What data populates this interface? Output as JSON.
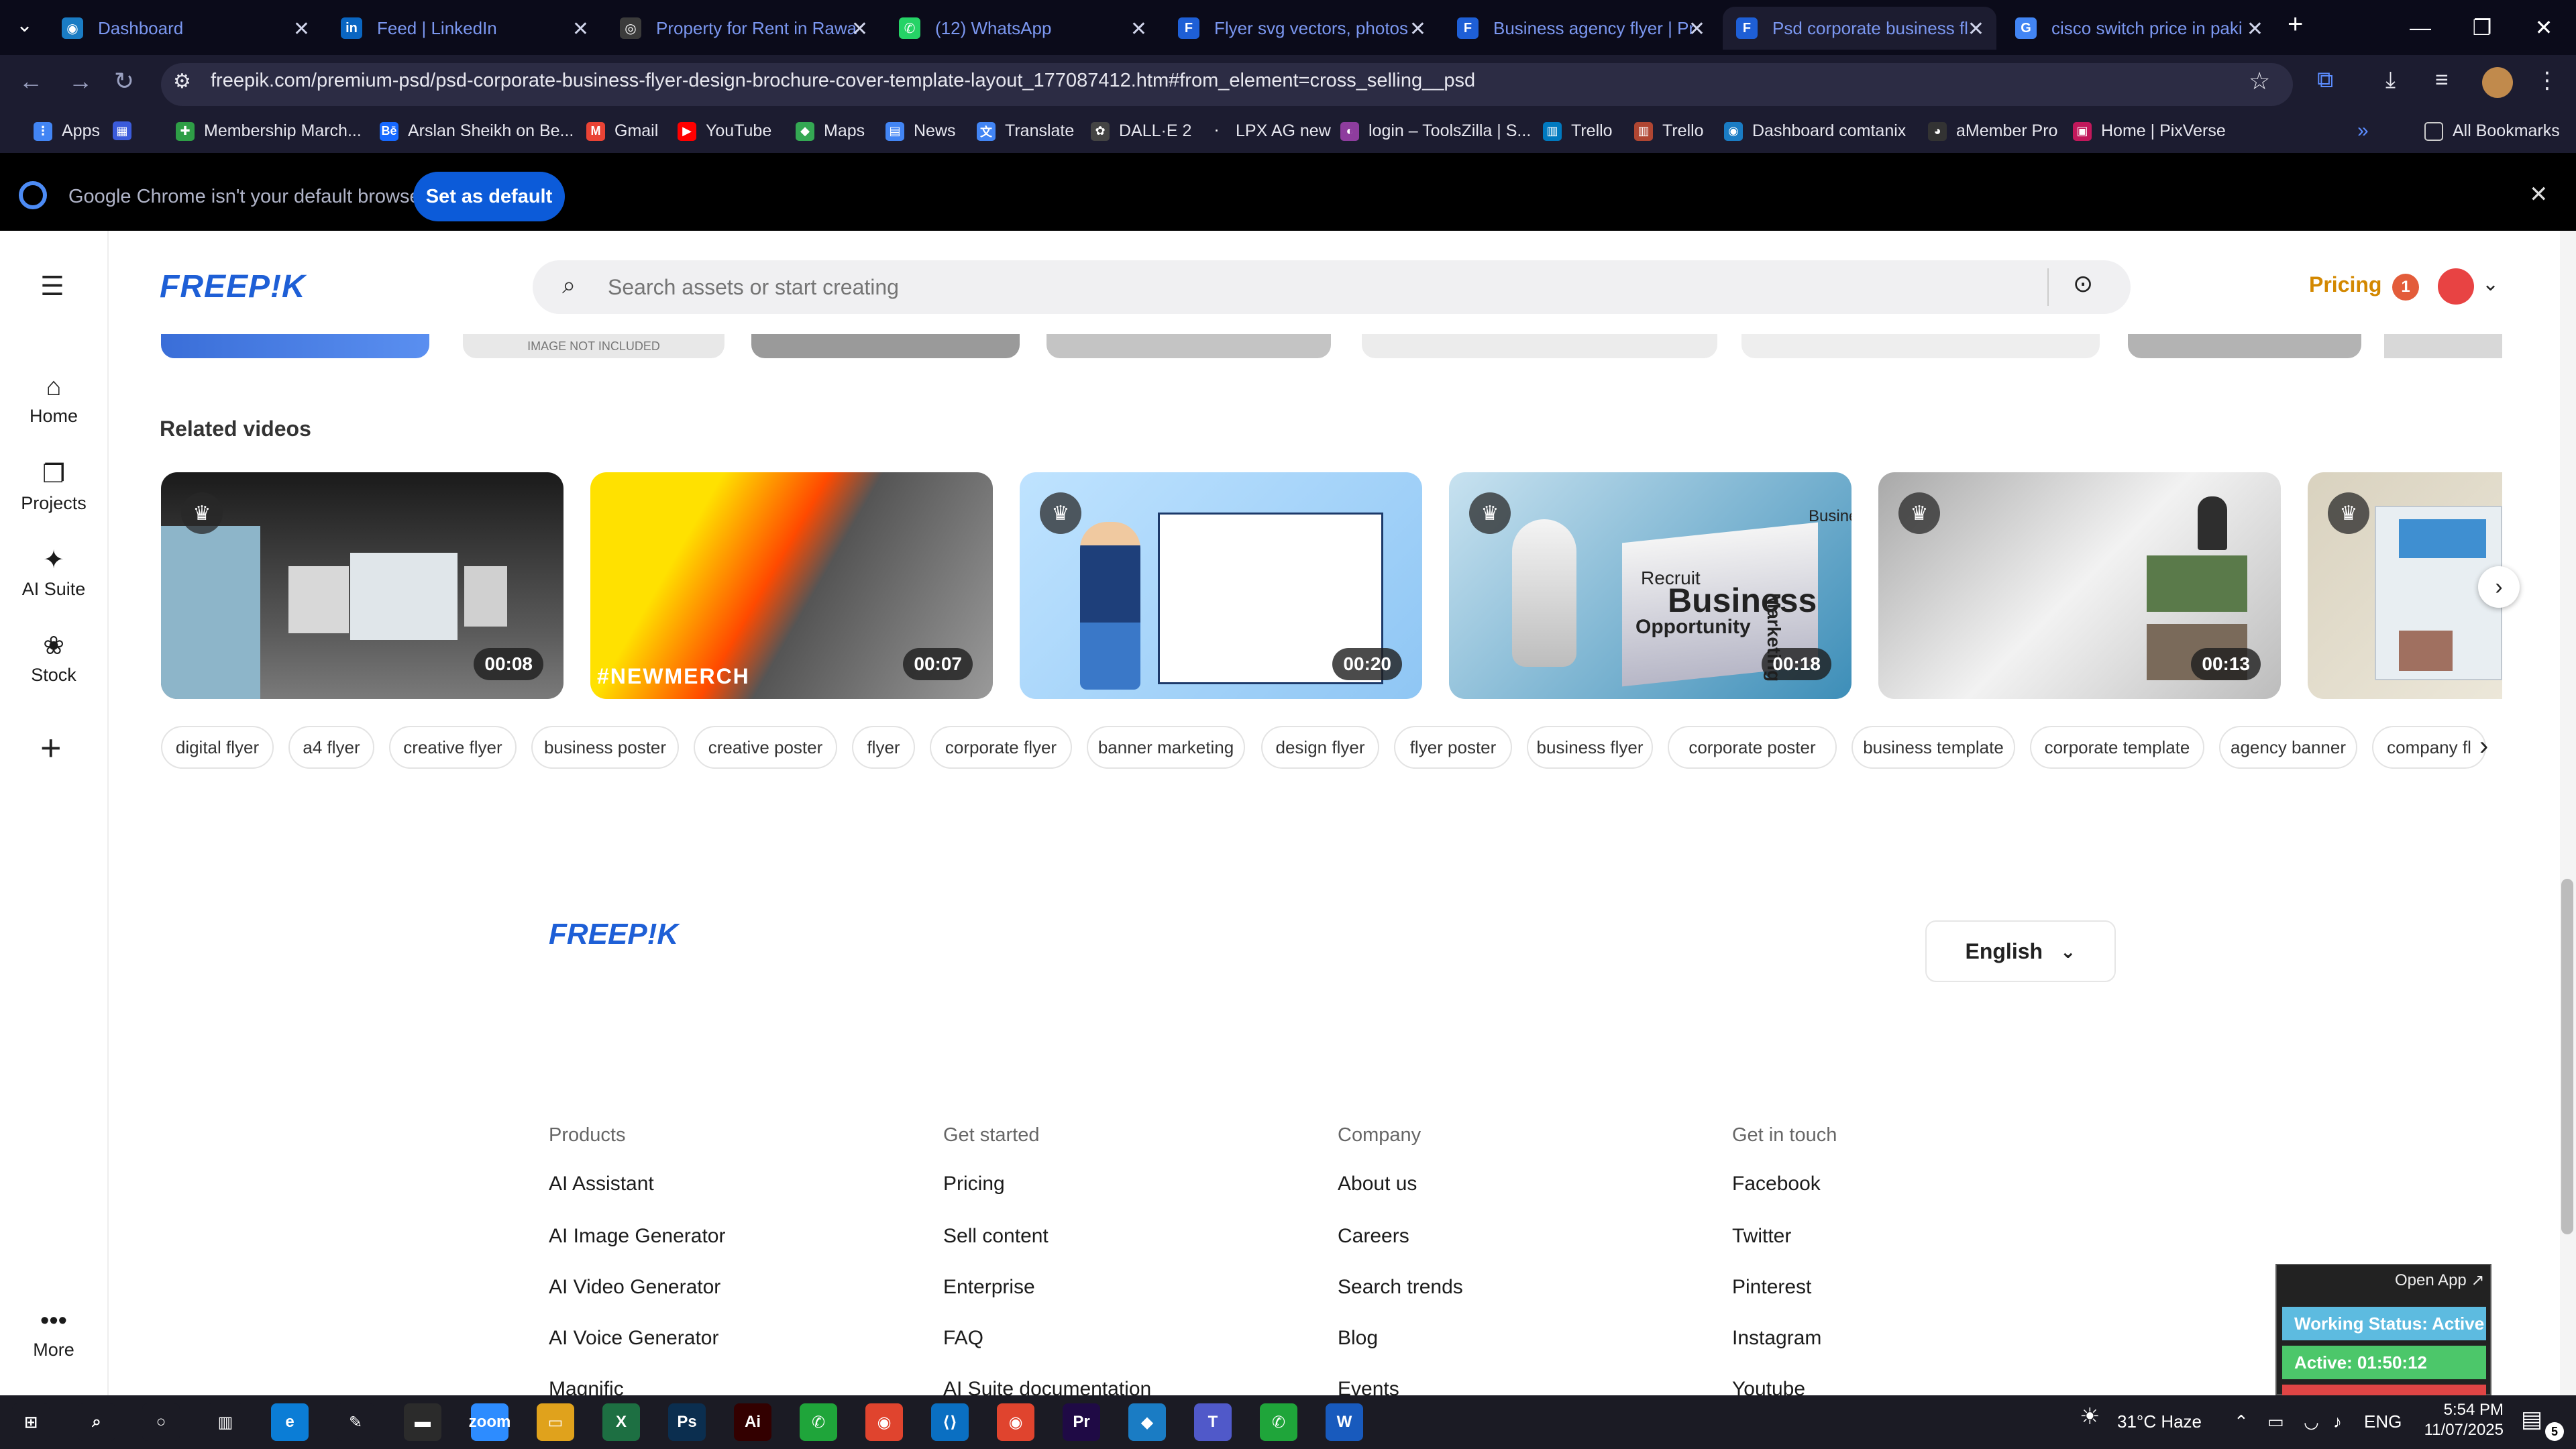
{
  "browser": {
    "tabs": [
      {
        "title": "Dashboard",
        "fav_color": "#1a7cc4",
        "fav_glyph": "◉"
      },
      {
        "title": "Feed | LinkedIn",
        "fav_color": "#0a66c2",
        "fav_glyph": "in"
      },
      {
        "title": "Property for Rent in Rawa",
        "fav_color": "#3b3b3b",
        "fav_glyph": "◎"
      },
      {
        "title": "(12) WhatsApp",
        "fav_color": "#25d366",
        "fav_glyph": "✆"
      },
      {
        "title": "Flyer svg vectors, photos",
        "fav_color": "#1e5fd6",
        "fav_glyph": "F"
      },
      {
        "title": "Business agency flyer | Pr",
        "fav_color": "#1e5fd6",
        "fav_glyph": "F"
      },
      {
        "title": "Psd corporate business fl",
        "fav_color": "#1e5fd6",
        "fav_glyph": "F"
      },
      {
        "title": "cisco switch price in paki",
        "fav_color": "#4285f4",
        "fav_glyph": "G"
      }
    ],
    "url": "freepik.com/premium-psd/psd-corporate-business-flyer-design-brochure-cover-template-layout_177087412.htm#from_element=cross_selling__psd",
    "bookmarks": [
      {
        "label": "Apps",
        "color": "#4285f4",
        "glyph": "⋮"
      },
      {
        "label": "",
        "color": "#3b5bdb",
        "glyph": "▦"
      },
      {
        "label": "Membership March...",
        "color": "#2e9e46",
        "glyph": "✚"
      },
      {
        "label": "Arslan Sheikh on Be...",
        "color": "#1769ff",
        "glyph": "Bē"
      },
      {
        "label": "Gmail",
        "color": "#ea4335",
        "glyph": "M"
      },
      {
        "label": "YouTube",
        "color": "#ff0000",
        "glyph": "▶"
      },
      {
        "label": "Maps",
        "color": "#34a853",
        "glyph": "◆"
      },
      {
        "label": "News",
        "color": "#4285f4",
        "glyph": "▤"
      },
      {
        "label": "Translate",
        "color": "#4285f4",
        "glyph": "文"
      },
      {
        "label": "DALL·E 2",
        "color": "#444",
        "glyph": "✿"
      },
      {
        "label": "LPX AG new",
        "color": "#1c1c30",
        "glyph": "·"
      },
      {
        "label": "login – ToolsZilla | S...",
        "color": "#8e3d9e",
        "glyph": "◐"
      },
      {
        "label": "Trello",
        "color": "#0079bf",
        "glyph": "▥"
      },
      {
        "label": "Trello",
        "color": "#b04632",
        "glyph": "▥"
      },
      {
        "label": "Dashboard comtanix",
        "color": "#1a7cc4",
        "glyph": "◉"
      },
      {
        "label": "aMember Pro",
        "color": "#333",
        "glyph": "◕"
      },
      {
        "label": "Home | PixVerse",
        "color": "#c2185b",
        "glyph": "▣"
      }
    ],
    "all_bookmarks": "All Bookmarks",
    "infobar_text": "Google Chrome isn't your default browser",
    "set_default": "Set as default"
  },
  "site": {
    "logo": "FREEP!K",
    "search_placeholder": "Search assets or start creating",
    "pricing": "Pricing",
    "notif_count": "1",
    "image_not_included": "IMAGE NOT INCLUDED",
    "sidebar": [
      {
        "label": "Home",
        "glyph": "⌂"
      },
      {
        "label": "Projects",
        "glyph": "❐"
      },
      {
        "label": "AI Suite",
        "glyph": "✦"
      },
      {
        "label": "Stock",
        "glyph": "❀"
      }
    ],
    "more": "More",
    "related_videos": "Related videos",
    "videos": [
      {
        "duration": "00:08"
      },
      {
        "duration": "00:07",
        "overlay": "#NEWMERCH"
      },
      {
        "duration": "00:20"
      },
      {
        "duration": "00:18",
        "text1": "Recruit",
        "text2": "Business",
        "text3": "Opportunity",
        "text4": "Marketing",
        "text5": "Busines"
      },
      {
        "duration": "00:13"
      },
      {
        "duration": ""
      }
    ],
    "tags": [
      "digital flyer",
      "a4 flyer",
      "creative flyer",
      "business poster",
      "creative poster",
      "flyer",
      "corporate flyer",
      "banner marketing",
      "design flyer",
      "flyer poster",
      "business flyer",
      "corporate poster",
      "business template",
      "corporate template",
      "agency banner",
      "company fl"
    ],
    "language": "English",
    "footer": {
      "columns": [
        {
          "heading": "Products",
          "links": [
            "AI Assistant",
            "AI Image Generator",
            "AI Video Generator",
            "AI Voice Generator",
            "Magnific"
          ]
        },
        {
          "heading": "Get started",
          "links": [
            "Pricing",
            "Sell content",
            "Enterprise",
            "FAQ",
            "AI Suite documentation"
          ]
        },
        {
          "heading": "Company",
          "links": [
            "About us",
            "Careers",
            "Search trends",
            "Blog",
            "Events"
          ]
        },
        {
          "heading": "Get in touch",
          "links": [
            "Facebook",
            "Twitter",
            "Pinterest",
            "Instagram",
            "Youtube"
          ]
        }
      ]
    }
  },
  "widget": {
    "open_app": "Open App ↗",
    "status": "Working Status: Active",
    "active": "Active: 01:50:12"
  },
  "taskbar": {
    "apps": [
      {
        "glyph": "⊞",
        "color": "#1b1b24"
      },
      {
        "glyph": "⌕",
        "color": "#1b1b24"
      },
      {
        "glyph": "○",
        "color": "#1b1b24"
      },
      {
        "glyph": "▥",
        "color": "#1b1b24"
      },
      {
        "glyph": "e",
        "color": "#0b7dd6"
      },
      {
        "glyph": "✎",
        "color": "#1b1b24"
      },
      {
        "glyph": "▬",
        "color": "#2b2b2b"
      },
      {
        "glyph": "zoom",
        "color": "#2d8cff"
      },
      {
        "glyph": "▭",
        "color": "#e0a21c"
      },
      {
        "glyph": "X",
        "color": "#1d6f42"
      },
      {
        "glyph": "Ps",
        "color": "#0b2e4f"
      },
      {
        "glyph": "Ai",
        "color": "#330000"
      },
      {
        "glyph": "✆",
        "color": "#1fa53a"
      },
      {
        "glyph": "◉",
        "color": "#e0442e"
      },
      {
        "glyph": "⟨⟩",
        "color": "#0a6fc2"
      },
      {
        "glyph": "◉",
        "color": "#e0442e"
      },
      {
        "glyph": "Pr",
        "color": "#1f0a45"
      },
      {
        "glyph": "◆",
        "color": "#1a7cc4"
      },
      {
        "glyph": "T",
        "color": "#5059c9"
      },
      {
        "glyph": "✆",
        "color": "#1fa53a"
      },
      {
        "glyph": "W",
        "color": "#185abd"
      }
    ],
    "weather": "31°C  Haze",
    "lang": "ENG",
    "time": "5:54 PM",
    "date": "11/07/2025",
    "notif": "5"
  }
}
